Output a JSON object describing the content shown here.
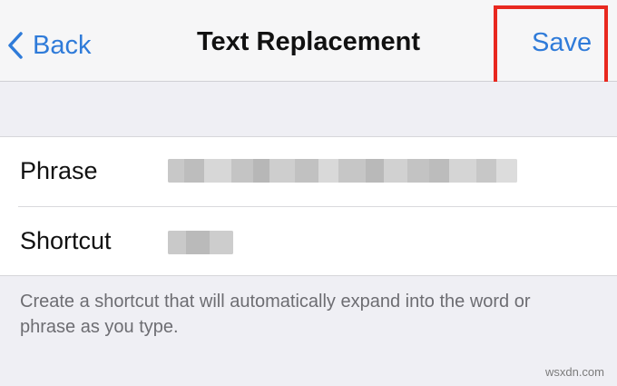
{
  "navbar": {
    "back_label": "Back",
    "title": "Text Replacement",
    "save_label": "Save"
  },
  "colors": {
    "accent": "#2f7bd9",
    "highlight_box": "#e8281f",
    "background": "#efeff4"
  },
  "form": {
    "phrase_label": "Phrase",
    "shortcut_label": "Shortcut"
  },
  "footer": {
    "note": "Create a shortcut that will automatically expand into the word or phrase as you type."
  },
  "watermark": "wsxdn.com"
}
